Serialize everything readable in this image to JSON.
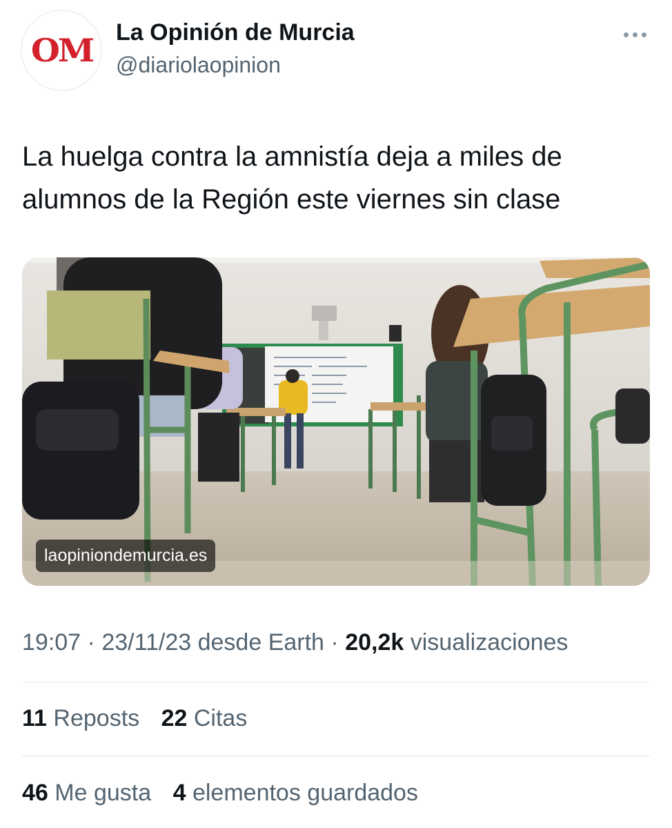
{
  "author": {
    "display_name": "La Opinión de Murcia",
    "handle": "@diariolaopinion",
    "avatar_text": "OM",
    "avatar_color": "#d3202b",
    "more_icon": "more-horizontal-icon"
  },
  "tweet": {
    "text": "La huelga contra la amnistía deja a miles de alumnos de la Región este viernes sin clase"
  },
  "media": {
    "domain": "laopiniondemurcia.es"
  },
  "meta": {
    "time": "19:07",
    "date": "23/11/23",
    "source": "desde Earth",
    "views_count": "20,2k",
    "views_label": "visualizaciones"
  },
  "stats": {
    "reposts_count": "11",
    "reposts_label": "Reposts",
    "quotes_count": "22",
    "quotes_label": "Citas",
    "likes_count": "46",
    "likes_label": "Me gusta",
    "bookmarks_count": "4",
    "bookmarks_label": "elementos guardados"
  },
  "colors": {
    "text_primary": "#0f1419",
    "text_secondary": "#536471",
    "divider": "#e1e8ed"
  }
}
